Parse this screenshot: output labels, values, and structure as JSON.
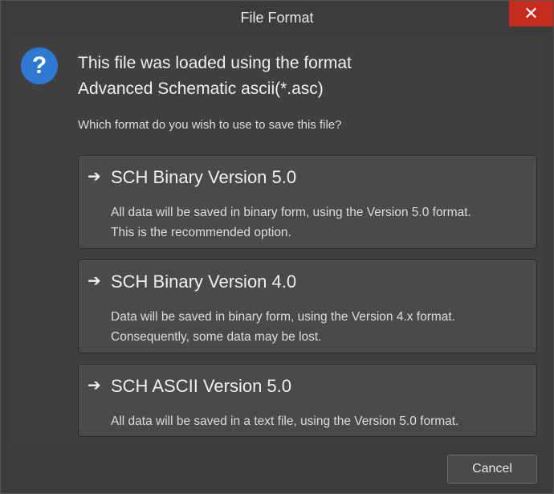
{
  "window": {
    "title": "File Format",
    "close_glyph": "✕"
  },
  "prompt": {
    "icon_glyph": "?",
    "heading_line1": "This file was loaded using the format",
    "heading_line2": "Advanced Schematic ascii(*.asc)",
    "question": "Which format do you wish to use to save this file?"
  },
  "options": [
    {
      "arrow": "➔",
      "title": "SCH Binary Version 5.0",
      "desc_line1": "All data will be saved in binary form, using the Version 5.0 format.",
      "desc_line2": "This is the recommended option."
    },
    {
      "arrow": "➔",
      "title": "SCH Binary Version 4.0",
      "desc_line1": "Data will be saved in binary form, using the Version 4.x format.",
      "desc_line2": "Consequently, some data may be lost."
    },
    {
      "arrow": "➔",
      "title": "SCH ASCII Version 5.0",
      "desc_line1": "All data will be saved in a text file, using the Version 5.0 format."
    }
  ],
  "footer": {
    "cancel_label": "Cancel"
  },
  "colors": {
    "close_button": "#c42b1c",
    "question_icon": "#2f79d4",
    "background": "#3c3c3c"
  },
  "icons": [
    "close-icon",
    "question-icon",
    "arrow-right-icon"
  ]
}
